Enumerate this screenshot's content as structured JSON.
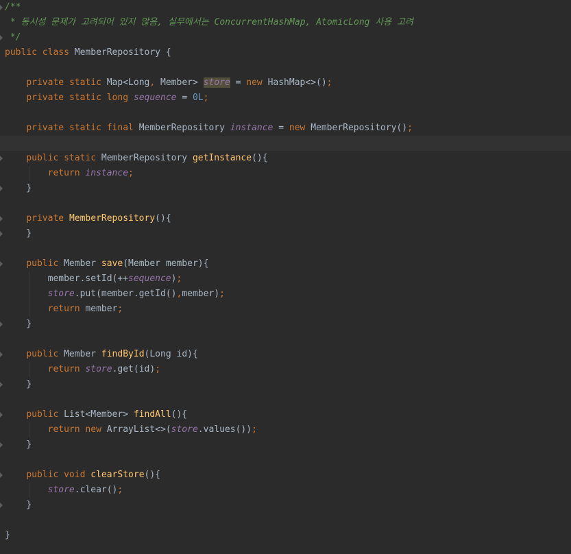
{
  "editor": {
    "language": "java",
    "lines": [
      [
        {
          "t": "/**",
          "c": "cm"
        }
      ],
      [
        {
          "t": " * 동시성 문제가 고려되어 있지 않음, 실무에서는 ConcurrentHashMap, AtomicLong 사용 고려",
          "c": "cm"
        }
      ],
      [
        {
          "t": " */",
          "c": "cm"
        }
      ],
      [
        {
          "t": "public ",
          "c": "kw"
        },
        {
          "t": "class ",
          "c": "kw"
        },
        {
          "t": "MemberRepository {",
          "c": "plain"
        }
      ],
      [],
      [
        {
          "t": "    ",
          "c": "plain"
        },
        {
          "t": "private ",
          "c": "kw"
        },
        {
          "t": "static ",
          "c": "kw"
        },
        {
          "t": "Map<Long",
          "c": "plain"
        },
        {
          "t": ", ",
          "c": "punc"
        },
        {
          "t": "Member> ",
          "c": "plain"
        },
        {
          "t": "store",
          "c": "fld hl-usage"
        },
        {
          "t": " = ",
          "c": "plain"
        },
        {
          "t": "new ",
          "c": "kw"
        },
        {
          "t": "HashMap<>()",
          "c": "plain"
        },
        {
          "t": ";",
          "c": "punc"
        }
      ],
      [
        {
          "t": "    ",
          "c": "plain"
        },
        {
          "t": "private ",
          "c": "kw"
        },
        {
          "t": "static ",
          "c": "kw"
        },
        {
          "t": "long ",
          "c": "kw"
        },
        {
          "t": "sequence",
          "c": "fld"
        },
        {
          "t": " = ",
          "c": "plain"
        },
        {
          "t": "0L",
          "c": "num"
        },
        {
          "t": ";",
          "c": "punc"
        }
      ],
      [],
      [
        {
          "t": "    ",
          "c": "plain"
        },
        {
          "t": "private ",
          "c": "kw"
        },
        {
          "t": "static ",
          "c": "kw"
        },
        {
          "t": "final ",
          "c": "kw"
        },
        {
          "t": "MemberRepository ",
          "c": "plain"
        },
        {
          "t": "instance",
          "c": "fld"
        },
        {
          "t": " = ",
          "c": "plain"
        },
        {
          "t": "new ",
          "c": "kw"
        },
        {
          "t": "MemberRepository()",
          "c": "plain"
        },
        {
          "t": ";",
          "c": "punc"
        }
      ],
      [],
      [
        {
          "t": "    ",
          "c": "plain"
        },
        {
          "t": "public ",
          "c": "kw"
        },
        {
          "t": "static ",
          "c": "kw"
        },
        {
          "t": "MemberRepository ",
          "c": "plain"
        },
        {
          "t": "getInstance",
          "c": "fn"
        },
        {
          "t": "(){",
          "c": "plain"
        }
      ],
      [
        {
          "t": "        ",
          "c": "plain"
        },
        {
          "t": "return ",
          "c": "kw"
        },
        {
          "t": "instance",
          "c": "fld"
        },
        {
          "t": ";",
          "c": "punc"
        }
      ],
      [
        {
          "t": "    }",
          "c": "plain"
        }
      ],
      [],
      [
        {
          "t": "    ",
          "c": "plain"
        },
        {
          "t": "private ",
          "c": "kw"
        },
        {
          "t": "MemberRepository",
          "c": "fn"
        },
        {
          "t": "(){",
          "c": "plain"
        }
      ],
      [
        {
          "t": "    }",
          "c": "plain"
        }
      ],
      [],
      [
        {
          "t": "    ",
          "c": "plain"
        },
        {
          "t": "public ",
          "c": "kw"
        },
        {
          "t": "Member ",
          "c": "plain"
        },
        {
          "t": "save",
          "c": "fn"
        },
        {
          "t": "(Member member){",
          "c": "plain"
        }
      ],
      [
        {
          "t": "        member.setId(++",
          "c": "plain"
        },
        {
          "t": "sequence",
          "c": "fld"
        },
        {
          "t": ")",
          "c": "plain"
        },
        {
          "t": ";",
          "c": "punc"
        }
      ],
      [
        {
          "t": "        ",
          "c": "plain"
        },
        {
          "t": "store",
          "c": "fld"
        },
        {
          "t": ".put(member.getId()",
          "c": "plain"
        },
        {
          "t": ",",
          "c": "punc"
        },
        {
          "t": "member)",
          "c": "plain"
        },
        {
          "t": ";",
          "c": "punc"
        }
      ],
      [
        {
          "t": "        ",
          "c": "plain"
        },
        {
          "t": "return ",
          "c": "kw"
        },
        {
          "t": "member",
          "c": "plain"
        },
        {
          "t": ";",
          "c": "punc"
        }
      ],
      [
        {
          "t": "    }",
          "c": "plain"
        }
      ],
      [],
      [
        {
          "t": "    ",
          "c": "plain"
        },
        {
          "t": "public ",
          "c": "kw"
        },
        {
          "t": "Member ",
          "c": "plain"
        },
        {
          "t": "findById",
          "c": "fn"
        },
        {
          "t": "(Long id){",
          "c": "plain"
        }
      ],
      [
        {
          "t": "        ",
          "c": "plain"
        },
        {
          "t": "return ",
          "c": "kw"
        },
        {
          "t": "store",
          "c": "fld"
        },
        {
          "t": ".get(id)",
          "c": "plain"
        },
        {
          "t": ";",
          "c": "punc"
        }
      ],
      [
        {
          "t": "    }",
          "c": "plain"
        }
      ],
      [],
      [
        {
          "t": "    ",
          "c": "plain"
        },
        {
          "t": "public ",
          "c": "kw"
        },
        {
          "t": "List<Member> ",
          "c": "plain"
        },
        {
          "t": "findAll",
          "c": "fn"
        },
        {
          "t": "(){",
          "c": "plain"
        }
      ],
      [
        {
          "t": "        ",
          "c": "plain"
        },
        {
          "t": "return ",
          "c": "kw"
        },
        {
          "t": "new ",
          "c": "kw"
        },
        {
          "t": "ArrayList<>(",
          "c": "plain"
        },
        {
          "t": "store",
          "c": "fld"
        },
        {
          "t": ".values())",
          "c": "plain"
        },
        {
          "t": ";",
          "c": "punc"
        }
      ],
      [
        {
          "t": "    }",
          "c": "plain"
        }
      ],
      [],
      [
        {
          "t": "    ",
          "c": "plain"
        },
        {
          "t": "public ",
          "c": "kw"
        },
        {
          "t": "void ",
          "c": "kw"
        },
        {
          "t": "clearStore",
          "c": "fn"
        },
        {
          "t": "(){",
          "c": "plain"
        }
      ],
      [
        {
          "t": "        ",
          "c": "plain"
        },
        {
          "t": "store",
          "c": "fld"
        },
        {
          "t": ".clear()",
          "c": "plain"
        },
        {
          "t": ";",
          "c": "punc"
        }
      ],
      [
        {
          "t": "    }",
          "c": "plain"
        }
      ],
      [],
      [
        {
          "t": "}",
          "c": "plain"
        }
      ]
    ],
    "colors": {
      "background": "#2b2b2b",
      "keyword": "#cc7832",
      "comment": "#629755",
      "field": "#9876aa",
      "method": "#ffc66d",
      "number": "#6897bb",
      "text": "#a9b7c6",
      "current_line": "#323232",
      "usage_highlight": "#52503a"
    }
  }
}
